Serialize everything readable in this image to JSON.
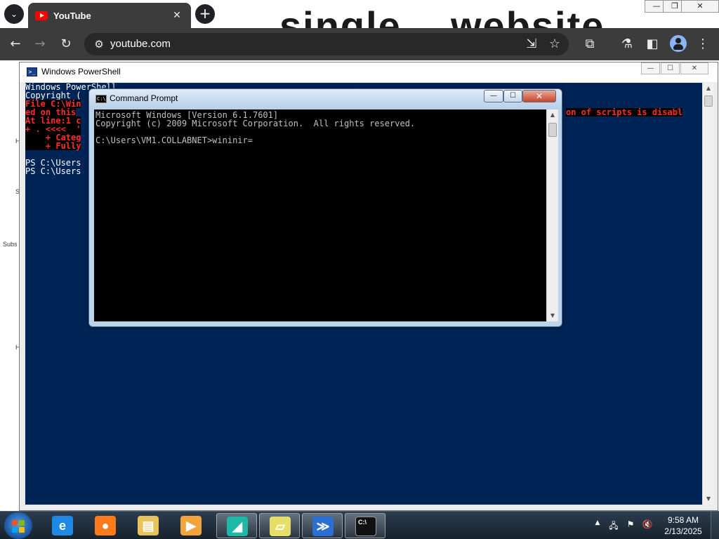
{
  "browser": {
    "tab_title": "YouTube",
    "tab_close": "✕",
    "new_tab": "+",
    "url": "youtube.com",
    "background_words": [
      "single",
      "website"
    ],
    "window_controls": {
      "minimize": "—",
      "restore": "❐",
      "close": "✕"
    },
    "icons": {
      "back": "←",
      "forward": "→",
      "reload": "↻",
      "site_info": "⚙",
      "install": "⇲",
      "bookmark": "☆",
      "extensions": "⧉",
      "labs": "⚗",
      "side_panel": "◧",
      "menu": "⋮",
      "tab_dropdown": "⌄"
    }
  },
  "page_behind": {
    "letters": [
      "H",
      "S",
      "Subs",
      "H"
    ]
  },
  "powershell": {
    "title": "Windows PowerShell",
    "icon_text": ">_",
    "controls": {
      "minimize": "—",
      "maximize": "☐",
      "close": "✕"
    },
    "lines": [
      {
        "text": "Windows PowerShell",
        "kind": "normal"
      },
      {
        "text": "Copyright (",
        "kind": "normal"
      },
      {
        "text": "File C:\\Win",
        "kind": "error"
      },
      {
        "text": "ed on this",
        "kind": "error"
      },
      {
        "text": "At line:1 c",
        "kind": "error"
      },
      {
        "text": "+ . <<<<  '",
        "kind": "error"
      },
      {
        "text": "    + Categ",
        "kind": "error"
      },
      {
        "text": "    + Fully",
        "kind": "error"
      },
      {
        "text": "",
        "kind": "normal"
      },
      {
        "text": "PS C:\\Users",
        "kind": "normal"
      },
      {
        "text": "PS C:\\Users",
        "kind": "normal"
      }
    ],
    "right_fragment": "on of scripts is disabl"
  },
  "cmd": {
    "title": "Command Prompt",
    "icon_text": "C:\\",
    "controls": {
      "minimize": "—",
      "maximize": "☐",
      "close": "✕"
    },
    "lines": [
      "Microsoft Windows [Version 6.1.7601]",
      "Copyright (c) 2009 Microsoft Corporation.  All rights reserved.",
      "",
      "C:\\Users\\VM1.COLLABNET>wininir="
    ]
  },
  "scroll_arrows": {
    "up": "▲",
    "down": "▼"
  },
  "taskbar": {
    "time": "9:58 AM",
    "date": "2/13/2025",
    "apps": [
      {
        "name": "internet-explorer",
        "glyph": "e",
        "color": "#1e88e5"
      },
      {
        "name": "firefox",
        "glyph": "●",
        "color": "#ff7a1a"
      },
      {
        "name": "file-explorer",
        "glyph": "▤",
        "color": "#e8c25a"
      },
      {
        "name": "media-player",
        "glyph": "▶",
        "color": "#f2a33a"
      },
      {
        "name": "app-bird",
        "glyph": "◢",
        "color": "#1eb8a8"
      },
      {
        "name": "sticky-notes",
        "glyph": "▱",
        "color": "#e6de68"
      },
      {
        "name": "powershell",
        "glyph": "≫",
        "color": "#2a6fd1"
      },
      {
        "name": "command-prompt",
        "glyph": "C:\\",
        "color": "#111111"
      }
    ],
    "tray_icons": {
      "show_hidden": "▲",
      "network": "🖧",
      "flag": "⚑",
      "volume_muted": "🔇"
    }
  }
}
